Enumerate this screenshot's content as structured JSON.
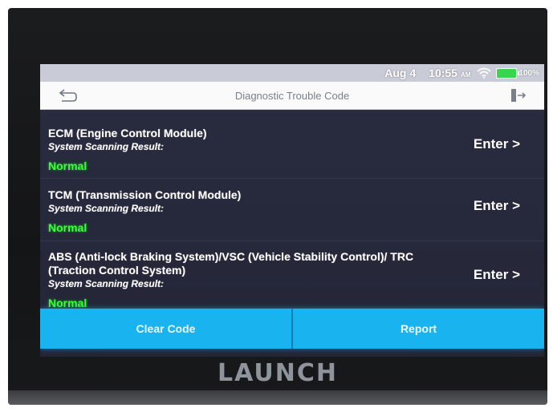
{
  "status_bar": {
    "date": "Aug 4",
    "time": "10:55",
    "ampm": "AM",
    "battery_percent": "100%",
    "icons": {
      "wifi": "wifi-icon",
      "battery": "battery-icon"
    }
  },
  "header": {
    "title": "Diagnostic Trouble Code",
    "back_icon": "back-icon",
    "exit_icon": "exit-icon"
  },
  "modules": [
    {
      "name": "ECM (Engine Control Module)",
      "scan_label": "System Scanning Result:",
      "result": "Normal",
      "enter_label": "Enter >"
    },
    {
      "name": "TCM (Transmission Control Module)",
      "scan_label": "System Scanning Result:",
      "result": "Normal",
      "enter_label": "Enter >"
    },
    {
      "name": "ABS (Anti-lock Braking System)/VSC (Vehicle Stability Control)/ TRC (Traction Control System)",
      "scan_label": "System Scanning Result:",
      "result": "Normal",
      "enter_label": "Enter >"
    }
  ],
  "actions": {
    "clear_code": "Clear Code",
    "report": "Report"
  },
  "brand": {
    "logo_text": "LAUNCH"
  },
  "colors": {
    "accent": "#19b4f0",
    "normal_status": "#39ff3a",
    "screen_bg": "#27293d",
    "battery": "#38d64e"
  }
}
